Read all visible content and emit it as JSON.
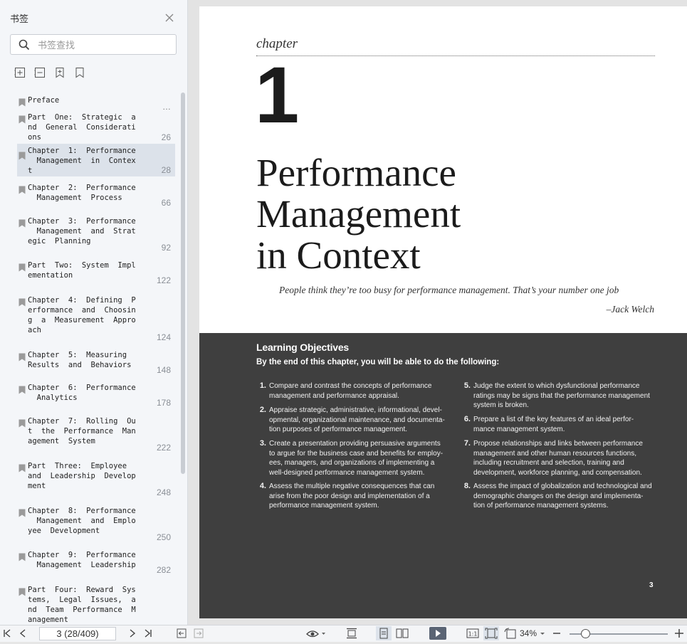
{
  "sidebar": {
    "title": "书签",
    "search_placeholder": "书签查找",
    "more_dots": "…",
    "bookmarks": [
      {
        "label": "Preface",
        "page": ""
      },
      {
        "label": "Part  One:  Strategic  a\nnd  General  Considerati\nons",
        "page": "26"
      },
      {
        "label": "Chapter  1:  Performance\n  Management  in  Contex\nt",
        "page": "28"
      },
      {
        "label": "Chapter  2:  Performance\n  Management  Process",
        "page": "66"
      },
      {
        "label": "Chapter  3:  Performance\n  Management  and  Strat\negic  Planning",
        "page": "92"
      },
      {
        "label": "Part  Two:  System  Impl\nementation",
        "page": "122"
      },
      {
        "label": "Chapter  4:  Defining  P\nerformance  and  Choosin\ng  a  Measurement  Appro\nach",
        "page": "124"
      },
      {
        "label": "Chapter  5:  Measuring\nResults  and  Behaviors",
        "page": "148"
      },
      {
        "label": "Chapter  6:  Performance\n  Analytics",
        "page": "178"
      },
      {
        "label": "Chapter  7:  Rolling  Ou\nt  the  Performance  Man\nagement  System",
        "page": "222"
      },
      {
        "label": "Part  Three:  Employee\nand  Leadership  Develop\nment",
        "page": "248"
      },
      {
        "label": "Chapter  8:  Performance\n  Management  and  Emplo\nyee  Development",
        "page": "250"
      },
      {
        "label": "Chapter  9:  Performance\n  Management  Leadership",
        "page": "282"
      },
      {
        "label": "Part  Four:  Reward  Sys\ntems,  Legal  Issues,  a\nnd  Team  Performance  M\nanagement",
        "page": ""
      }
    ]
  },
  "page": {
    "chapter_word": "chapter",
    "chapter_number": "1",
    "title_lines": [
      "Performance",
      "Management",
      "in Context"
    ],
    "quote": "People think they’re too busy for performance management. That’s your number one job",
    "quote_author": "–Jack Welch",
    "objectives_title": "Learning Objectives",
    "objectives_intro": "By the end of this chapter, you will be able to do the following:",
    "objectives": [
      {
        "num": "1.",
        "lines": [
          "Compare and contrast the concepts of performance",
          "management and performance appraisal."
        ]
      },
      {
        "num": "2.",
        "lines": [
          "Appraise strategic, administrative, informational, devel-",
          "opmental, organizational maintenance, and documenta-",
          "tion purposes of performance management."
        ]
      },
      {
        "num": "3.",
        "lines": [
          "Create a presentation providing persuasive arguments",
          "to argue for the business case and benefits for employ-",
          "ees, managers, and organizations of implementing a",
          "well-designed performance management system."
        ]
      },
      {
        "num": "4.",
        "lines": [
          "Assess the multiple negative consequences that can",
          "arise from the poor design and implementation of a",
          "performance management system."
        ]
      },
      {
        "num": "5.",
        "lines": [
          "Judge the extent to which dysfunctional performance",
          "ratings may be signs that the performance management",
          "system is broken."
        ]
      },
      {
        "num": "6.",
        "lines": [
          "Prepare a list of the key features of an ideal perfor-",
          "mance management system."
        ]
      },
      {
        "num": "7.",
        "lines": [
          "Propose relationships and links between performance",
          "management and other human resources functions,",
          "including recruitment and selection, training and",
          "development, workforce planning, and compensation."
        ]
      },
      {
        "num": "8.",
        "lines": [
          "Assess the impact of globalization and technological and",
          "demographic changes on the design and implementa-",
          "tion of performance management systems."
        ]
      }
    ],
    "page_number": "3"
  },
  "toolbar": {
    "page_indicator": "3 (28/409)",
    "zoom": "34%",
    "zoom_level_percent": 34
  }
}
